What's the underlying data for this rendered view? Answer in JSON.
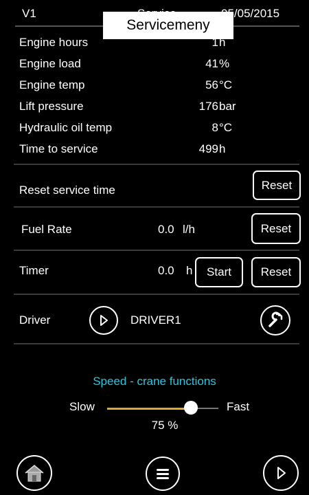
{
  "header": {
    "version": "V1",
    "title_partial": "Service",
    "date": "05/05/2015",
    "tooltip": "Servicemeny"
  },
  "readings": [
    {
      "label": "Engine hours",
      "value": "1",
      "unit": "h"
    },
    {
      "label": "Engine load",
      "value": "41",
      "unit": "%"
    },
    {
      "label": "Engine temp",
      "value": "56",
      "unit": "°C"
    },
    {
      "label": "Lift pressure",
      "value": "176",
      "unit": "bar"
    },
    {
      "label": "Hydraulic oil temp",
      "value": "8",
      "unit": "°C"
    },
    {
      "label": "Time to service",
      "value": "499",
      "unit": "h"
    }
  ],
  "reset_service": {
    "label": "Reset service time",
    "button": "Reset"
  },
  "fuel": {
    "label": "Fuel Rate",
    "value": "0.0",
    "unit": "l/h",
    "button": "Reset"
  },
  "timer": {
    "label": "Timer",
    "value": "0.0",
    "unit": "h",
    "start_button": "Start",
    "reset_button": "Reset"
  },
  "driver": {
    "label": "Driver",
    "name": "DRIVER1",
    "icons": [
      "play-icon",
      "wrench-icon"
    ]
  },
  "speed": {
    "title": "Speed - crane functions",
    "slow_label": "Slow",
    "fast_label": "Fast",
    "value_text": "75 %",
    "value": 0.75,
    "colors": {
      "title": "#27c7e2",
      "fill": "#e3a92c"
    }
  },
  "bottom_nav": {
    "icons": [
      "home-icon",
      "menu-icon",
      "play-icon"
    ]
  }
}
